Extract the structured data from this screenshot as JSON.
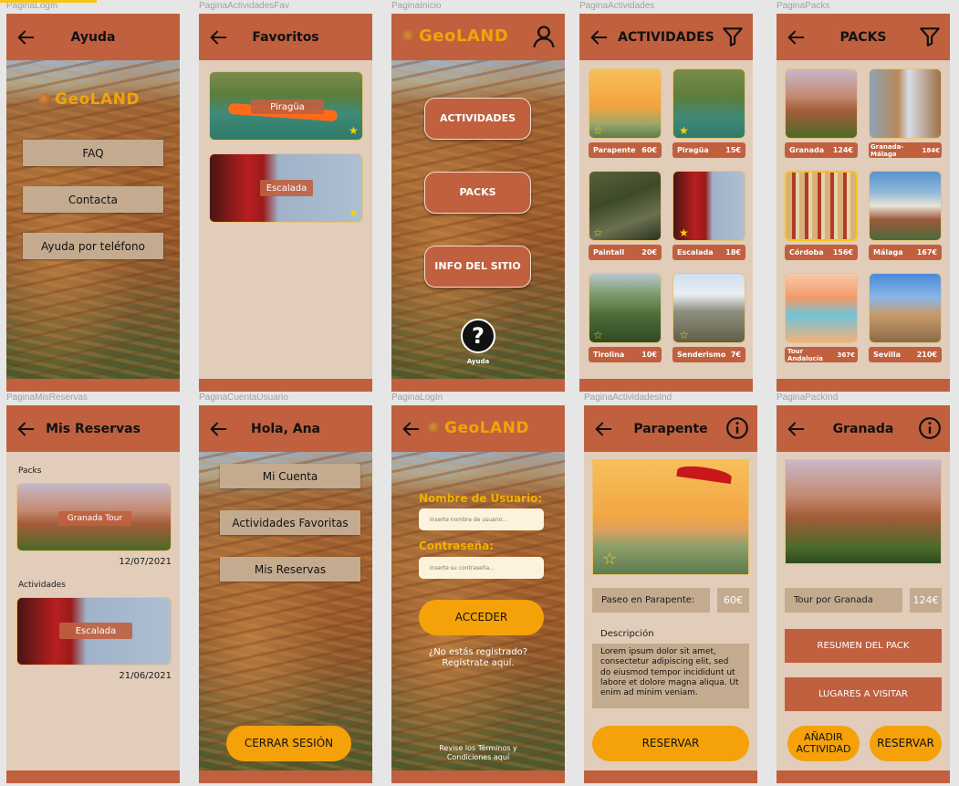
{
  "labels": {
    "ayuda": "PaginaLogIn",
    "favoritos": "PaginaActividadesFav",
    "inicio": "PaginaInicio",
    "actividades": "PaginaActividades",
    "packs": "PaginaPacks",
    "reservas": "PaginaMisReservas",
    "cuenta": "PaginaCuentaUsuario",
    "login": "PaginaLogIn",
    "actInd": "PaginaActividadesInd",
    "packInd": "PaginaPackInd"
  },
  "ayuda": {
    "title": "Ayuda",
    "logo": "GeoLAND",
    "buttons": [
      "FAQ",
      "Contacta",
      "Ayuda por teléfono"
    ]
  },
  "favoritos": {
    "title": "Favoritos",
    "items": [
      "Piragüa",
      "Escalada"
    ]
  },
  "inicio": {
    "logo": "GeoLAND",
    "buttons": [
      "ACTIVIDADES",
      "PACKS",
      "INFO DEL SITIO"
    ],
    "help": "Ayuda"
  },
  "actividades": {
    "title": "ACTIVIDADES",
    "items": [
      {
        "name": "Parapente",
        "price": "60€"
      },
      {
        "name": "Piragüa",
        "price": "15€"
      },
      {
        "name": "Paintall",
        "price": "20€"
      },
      {
        "name": "Escalada",
        "price": "18€"
      },
      {
        "name": "Tirolina",
        "price": "10€"
      },
      {
        "name": "Senderismo",
        "price": "7€"
      }
    ]
  },
  "packs": {
    "title": "PACKS",
    "items": [
      {
        "name": "Granada",
        "price": "124€"
      },
      {
        "name": "Granada-Málaga",
        "price": "184€"
      },
      {
        "name": "Córdoba",
        "price": "156€"
      },
      {
        "name": "Málaga",
        "price": "167€"
      },
      {
        "name": "Tour Andalucía",
        "price": "367€"
      },
      {
        "name": "Sevilla",
        "price": "210€"
      }
    ]
  },
  "reservas": {
    "title": "Mis Reservas",
    "packsLabel": "Packs",
    "pack": "Granada Tour",
    "packDate": "12/07/2021",
    "actLabel": "Actividades",
    "act": "Escalada",
    "actDate": "21/06/2021"
  },
  "cuenta": {
    "title": "Hola, Ana",
    "buttons": [
      "Mi Cuenta",
      "Actividades Favoritas",
      "Mis Reservas"
    ],
    "logout": "CERRAR SESIÓN"
  },
  "login": {
    "logo": "GeoLAND",
    "userLabel": "Nombre de Usuario:",
    "userPh": "Inserte nombre de usuario...",
    "passLabel": "Contraseña:",
    "passPh": "Inserte su contraseña...",
    "submit": "ACCEDER",
    "register": "¿No estás registrado? Regístrate aquí.",
    "terms": "Revise los Términos y Condiciones aquí"
  },
  "actInd": {
    "title": "Parapente",
    "tag": "Paseo en Parapente:",
    "price": "60€",
    "descTitle": "Descripción",
    "desc": "Lorem ipsum dolor sit amet, consectetur adipiscing elit, sed do eiusmod tempor incididunt ut labore et dolore magna aliqua. Ut enim ad minim veniam.",
    "reserve": "RESERVAR"
  },
  "packInd": {
    "title": "Granada",
    "tag": "Tour por Granada",
    "price": "124€",
    "summary": "RESUMEN DEL PACK",
    "places": "LUGARES A VISITAR",
    "add": "AÑADIR ACTIVIDAD",
    "reserve": "RESERVAR"
  },
  "colors": {
    "header": "#c0603f",
    "beige": "#e2ccba",
    "orange": "#f5a20a",
    "gold": "#ffd000"
  }
}
